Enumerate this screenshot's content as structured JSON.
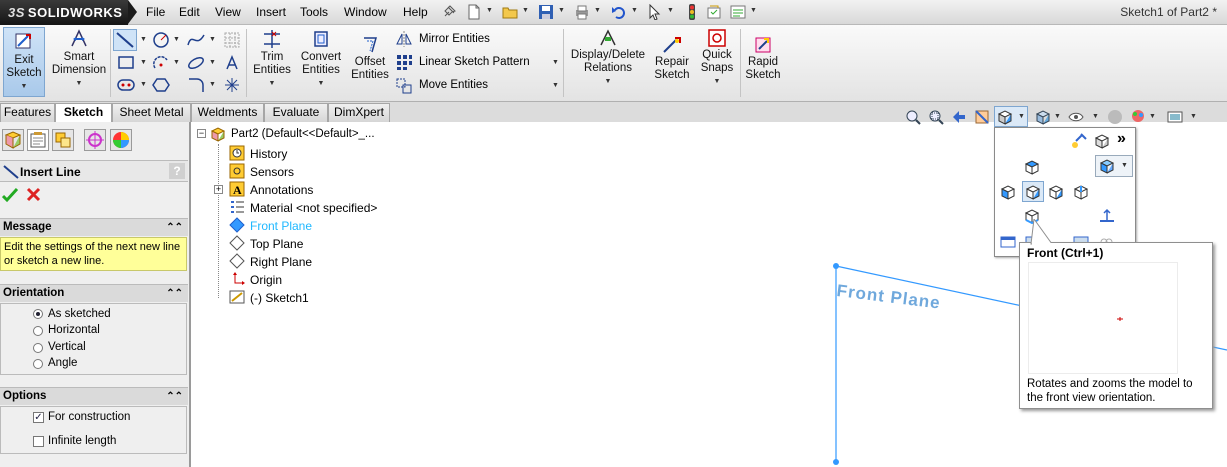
{
  "app": {
    "logo_text": "SOLIDWORKS",
    "logo_prefix": "3S",
    "document_title": "Sketch1 of Part2 *"
  },
  "menu": [
    "File",
    "Edit",
    "View",
    "Insert",
    "Tools",
    "Window",
    "Help"
  ],
  "ribbon": {
    "exit_sketch": "Exit Sketch",
    "smart_dimension": "Smart Dimension",
    "trim_entities": "Trim Entities",
    "convert_entities": "Convert Entities",
    "offset_entities": "Offset Entities",
    "mirror_entities": "Mirror Entities",
    "linear_sketch_pattern": "Linear Sketch Pattern",
    "move_entities": "Move Entities",
    "display_delete_relations": "Display/Delete Relations",
    "repair_sketch": "Repair Sketch",
    "quick_snaps": "Quick Snaps",
    "rapid_sketch": "Rapid Sketch"
  },
  "tabs": [
    "Features",
    "Sketch",
    "Sheet Metal",
    "Weldments",
    "Evaluate",
    "DimXpert"
  ],
  "active_tab": "Sketch",
  "property_manager": {
    "title": "Insert Line",
    "help": "?",
    "message_header": "Message",
    "message_text": "Edit the settings of the next new line or sketch a new line.",
    "orientation_header": "Orientation",
    "orientation_options": [
      "As sketched",
      "Horizontal",
      "Vertical",
      "Angle"
    ],
    "orientation_selected": "As sketched",
    "options_header": "Options",
    "for_construction": "For construction",
    "for_construction_checked": true,
    "infinite_length": "Infinite length",
    "infinite_length_checked": false
  },
  "tree": {
    "root": "Part2  (Default<<Default>_...",
    "items": [
      "History",
      "Sensors",
      "Annotations",
      "Material <not specified>",
      "Front Plane",
      "Top Plane",
      "Right Plane",
      "Origin",
      "(-) Sketch1"
    ],
    "highlighted": "Front Plane"
  },
  "viewport": {
    "plane_label": "Front Plane"
  },
  "tooltip": {
    "title": "Front   (Ctrl+1)",
    "description": "Rotates and zooms the model to the front view orientation."
  },
  "flyout": {
    "more": "»"
  },
  "colors": {
    "accent": "#3399ff",
    "message_bg": "#ffff99",
    "plane_text": "#6fa8dc",
    "highlight_text": "#1fb8ff"
  }
}
